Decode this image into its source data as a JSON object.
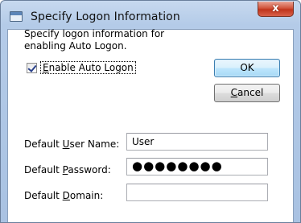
{
  "window": {
    "title": "Specify Logon Information",
    "close_glyph": "x"
  },
  "intro_text": "Specify logon information for enabling Auto Logon.",
  "checkbox": {
    "label_pre": "",
    "label_accel": "E",
    "label_post": "nable Auto Logon",
    "checked": true
  },
  "buttons": {
    "ok_label": "OK",
    "cancel_accel": "C",
    "cancel_rest": "ancel"
  },
  "fields": {
    "user": {
      "label_pre": "Default ",
      "label_accel": "U",
      "label_post": "ser Name:",
      "value": "User"
    },
    "password": {
      "label_pre": "Default ",
      "label_accel": "P",
      "label_post": "assword:",
      "value": "●●●●●●●●"
    },
    "domain": {
      "label_pre": "Default ",
      "label_accel": "D",
      "label_post": "omain:",
      "value": ""
    }
  },
  "colors": {
    "title_bar": "#b4cbe8",
    "close_button": "#c7432a",
    "default_button": "#3c7fb1"
  },
  "icons": {
    "app": "window-icon",
    "check": "checkmark-icon"
  }
}
